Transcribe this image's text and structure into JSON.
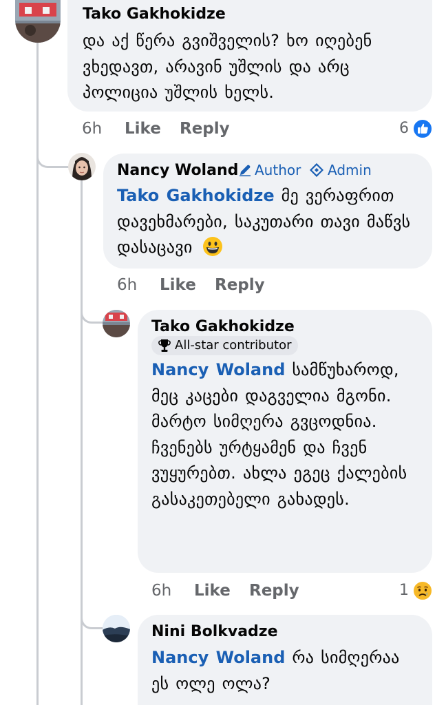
{
  "comments": [
    {
      "author": "Tako Gakhokidze",
      "text": "და აქ წერა გვიშველის? ხო იღებენ ვხედავთ, არავინ უშლის და არც პოლიცია უშლის ხელს.",
      "time": "6h",
      "like_label": "Like",
      "reply_label": "Reply",
      "reaction_count": "6",
      "reaction_icon": "like-icon"
    },
    {
      "author": "Nancy Woland",
      "tags": [
        "Author",
        "Admin"
      ],
      "mention": "Tako Gakhokidze",
      "text": "მე ვერაფრით დავეხმარები, საკუთარი თავი მაწვს დასაცავი",
      "emoji": "😀",
      "time": "6h",
      "like_label": "Like",
      "reply_label": "Reply"
    },
    {
      "author": "Tako Gakhokidze",
      "badge": "All-star contributor",
      "mention": "Nancy Woland",
      "text": "სამწუხაროდ, მეც კაცები დაგველია მგონი. მარტო სიმღერა გვცოდნია. ჩვენებს ურტყამენ და ჩვენ ვუყურებთ. ახლა ეგეც ქალების გასაკეთებელი გახადეს.",
      "time": "6h",
      "like_label": "Like",
      "reply_label": "Reply",
      "reaction_count": "1",
      "reaction_icon": "sad-icon"
    },
    {
      "author": "Nini Bolkvadze",
      "mention": "Nancy Woland",
      "text": "რა სიმღერაა ეს ოლე ოლა?"
    }
  ],
  "colors": {
    "bubble": "#f0f2f5",
    "link": "#1a5fb4",
    "meta": "#65676b",
    "like_blue": "#1877f2",
    "sad_yellow": "#f7b928"
  }
}
